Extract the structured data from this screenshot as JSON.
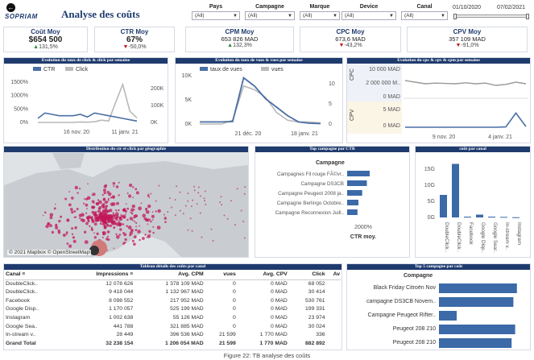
{
  "header": {
    "logo": "SOPRIAM",
    "title": "Analyse des coûts",
    "back_icon": "back-arrow-icon"
  },
  "filters": [
    {
      "label": "Pays",
      "value": "(All)"
    },
    {
      "label": "Campagne",
      "value": "(All)"
    },
    {
      "label": "Marque",
      "value": "(All)"
    },
    {
      "label": "Device",
      "value": "(All)"
    },
    {
      "label": "Canal",
      "value": "(All)"
    }
  ],
  "dates": {
    "start": "01/10/2020",
    "end": "07/02/2021"
  },
  "kpis": [
    {
      "title": "Coût Moy",
      "value": "$654 500",
      "delta": "131,5%",
      "dir": "up"
    },
    {
      "title": "CTR Moy",
      "value": "67%",
      "delta": "-50,0%",
      "dir": "down"
    },
    {
      "title": "CPM Moy",
      "value": "653 826 MAD",
      "delta": "132,3%",
      "dir": "up"
    },
    {
      "title": "CPC Moy",
      "value": "673,6 MAD",
      "delta": "-43,2%",
      "dir": "down"
    },
    {
      "title": "CPV Moy",
      "value": "357 109 MAD",
      "delta": "-91,0%",
      "dir": "down"
    }
  ],
  "charts": {
    "ctr_click": {
      "title": "Evolution du taux de click & click par semaine",
      "legend": [
        "CTR",
        "Click"
      ],
      "left_ticks": [
        "1500%",
        "1000%",
        "500%",
        "0%"
      ],
      "right_ticks": [
        "200K",
        "100K",
        "0K"
      ],
      "x_ticks": [
        "16 nov. 20",
        "11 janv. 21"
      ]
    },
    "vues": {
      "title": "Evolution du taux de vues & vues par semaine",
      "legend": [
        "taux de vues",
        "vues"
      ],
      "left_ticks": [
        "10K",
        "5K",
        "0K"
      ],
      "right_ticks": [
        "10",
        "5",
        "0"
      ],
      "x_ticks": [
        "21 déc. 20",
        "18 janv. 21"
      ]
    },
    "cpc_cpm": {
      "title": "Evolution du cpc & cpv & cpm par semaine",
      "cpc_label": "CPC",
      "cpv_label": "CPV",
      "cpc_ticks": [
        "10 000 MAD",
        "2 000 000 M..",
        "0 MAD"
      ],
      "cpv_ticks": [
        "5 MAD",
        "0 MAD"
      ],
      "x_ticks": [
        "9 nov. 20",
        "4 janv. 21"
      ]
    },
    "geo": {
      "title": "Distribution du ctr et click par géographie",
      "credit": "© 2021 Mapbox © OpenStreetMap"
    },
    "top_ctr": {
      "title": "Top campagne par CTR",
      "header": "Campagne",
      "axis_tick": "2000%",
      "axis_label": "CTR moy."
    },
    "cout_canal": {
      "title": "coût par canal"
    },
    "top5": {
      "title": "Top 5 campagne par coût",
      "header": "Compagne"
    },
    "table": {
      "title": "Tableau détails des coûts par canal"
    }
  },
  "chart_data": [
    {
      "type": "line",
      "title": "Evolution du taux de click & click par semaine",
      "series": [
        {
          "name": "CTR",
          "values": [
            150,
            350,
            300,
            250,
            250,
            250,
            300,
            200,
            350,
            300,
            250,
            200,
            150,
            100,
            50
          ]
        },
        {
          "name": "Click",
          "values": [
            0,
            0,
            0,
            0,
            0,
            0,
            2000,
            1000,
            3000,
            10000,
            6000,
            90000,
            170000,
            50000,
            20000
          ]
        }
      ],
      "ylim": [
        0,
        1500
      ]
    },
    {
      "type": "line",
      "title": "Evolution du taux de vues & vues par semaine",
      "series": [
        {
          "name": "taux de vues",
          "values": [
            500,
            500,
            500,
            600,
            11000,
            9000,
            6000,
            4000,
            2000,
            500,
            200,
            100
          ]
        },
        {
          "name": "vues",
          "values": [
            0,
            0,
            0,
            1,
            10,
            9,
            7,
            3,
            1,
            0.5,
            0.5,
            0.3
          ]
        }
      ],
      "ylim": [
        0,
        10000
      ]
    },
    {
      "type": "line",
      "title": "Evolution du cpc & cpv & cpm par semaine",
      "series": [
        {
          "name": "CPC",
          "values": [
            5000,
            4500,
            4000,
            4200,
            4100,
            4000,
            4300,
            4000,
            4200,
            3500,
            3800,
            4500,
            4000
          ]
        },
        {
          "name": "CPV",
          "values": [
            0,
            0,
            0,
            0,
            0,
            0,
            0,
            0,
            0,
            0,
            0.1,
            4,
            0.2
          ]
        }
      ]
    },
    {
      "type": "bar",
      "title": "Top campagne par CTR",
      "categories": [
        "Campagnes Fil rouge FÃ©vr..",
        "Campagne DS3CB",
        "Campagne Peugeot 2008 ja..",
        "Campagne Berlingo Octobre..",
        "Campagne Reconnexion Juill.."
      ],
      "values": [
        2400,
        2100,
        1600,
        1200,
        1100
      ],
      "xlabel": "CTR moy."
    },
    {
      "type": "bar",
      "title": "coût par canal",
      "categories": [
        "DoubleClick..",
        "DoubleClick..",
        "Facebook",
        "Google Disp..",
        "Google Sear..",
        "In-stream v..",
        "Instagram"
      ],
      "values": [
        8,
        19,
        0.3,
        1,
        0.3,
        0.2,
        0.1
      ],
      "yticks": [
        "15G",
        "10G",
        "5G",
        "0G"
      ]
    },
    {
      "type": "bar",
      "title": "Top 5 campagne par coût",
      "categories": [
        "Black Friday Citroën Nov",
        "campagne DS3CB Novem..",
        "Campagne Peugeot Rifter..",
        "Peugeot 208 210",
        "Peugeot 208 210"
      ],
      "values": [
        0.88,
        0.84,
        0.2,
        0.86,
        0.82
      ]
    },
    {
      "type": "table",
      "title": "Tableau détails des coûts par canal",
      "columns": [
        "Canal",
        "Impressions",
        "Avg. CPM",
        "vues",
        "Avg. CPV",
        "Click",
        "Av"
      ],
      "rows": [
        [
          "DoubleClick..",
          "12 078 626",
          "1 378 109 MAD",
          "0",
          "0 MAD",
          "68 052",
          ""
        ],
        [
          "DoubleClick..",
          "9 418 044",
          "1 132 967 MAD",
          "0",
          "0 MAD",
          "30 414",
          ""
        ],
        [
          "Facebook",
          "8 098 552",
          "217 952 MAD",
          "0",
          "0 MAD",
          "530 761",
          ""
        ],
        [
          "Google Disp..",
          "1 170 057",
          "525 199 MAD",
          "0",
          "0 MAD",
          "199 331",
          ""
        ],
        [
          "Instagram",
          "1 002 638",
          "55 126 MAD",
          "0",
          "0 MAD",
          "23 974",
          ""
        ],
        [
          "Google Sea..",
          "441 788",
          "321 885 MAD",
          "0",
          "0 MAD",
          "30 024",
          ""
        ],
        [
          "In-stream v..",
          "28 449",
          "396 536 MAD",
          "21 599",
          "1 770 MAD",
          "336",
          ""
        ],
        [
          "Grand Total",
          "32 238 154",
          "1 206 054 MAD",
          "21 599",
          "1 770 MAD",
          "882 892",
          ""
        ]
      ]
    }
  ],
  "caption": "Figure 22: TB analyse des coûts"
}
